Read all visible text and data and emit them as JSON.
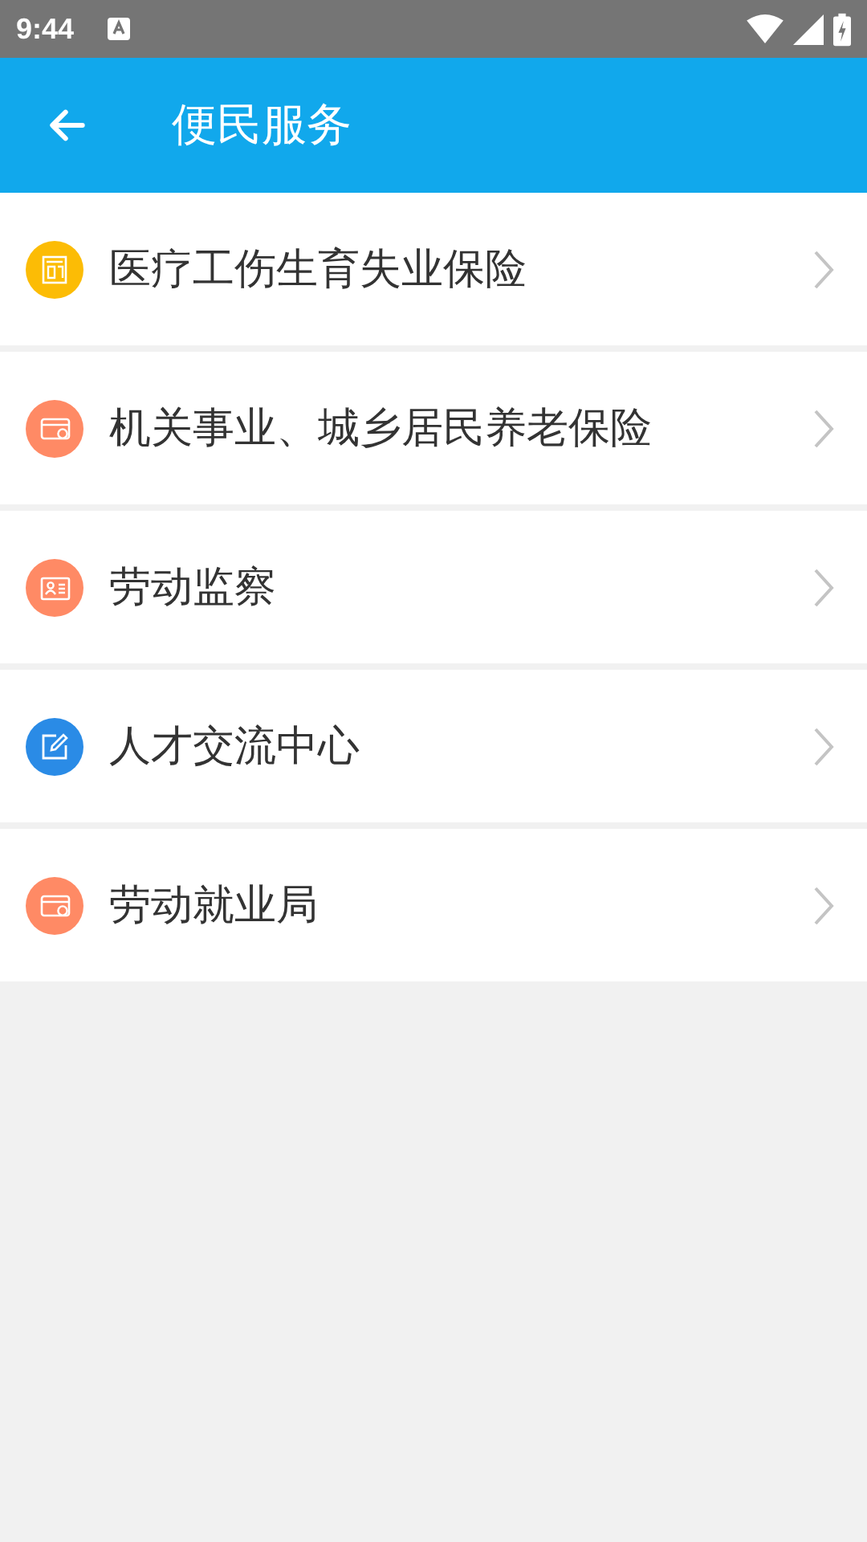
{
  "status_bar": {
    "time": "9:44"
  },
  "app_bar": {
    "title": "便民服务"
  },
  "items": [
    {
      "label": "医疗工伤生育失业保险",
      "kind": "building",
      "color": "#fcbc05"
    },
    {
      "label": "机关事业、城乡居民养老保险",
      "kind": "card",
      "color": "#ff8a65"
    },
    {
      "label": "劳动监察",
      "kind": "id",
      "color": "#ff8a65"
    },
    {
      "label": "人才交流中心",
      "kind": "edit",
      "color": "#2a8be6"
    },
    {
      "label": "劳动就业局",
      "kind": "card",
      "color": "#ff8a65"
    }
  ]
}
